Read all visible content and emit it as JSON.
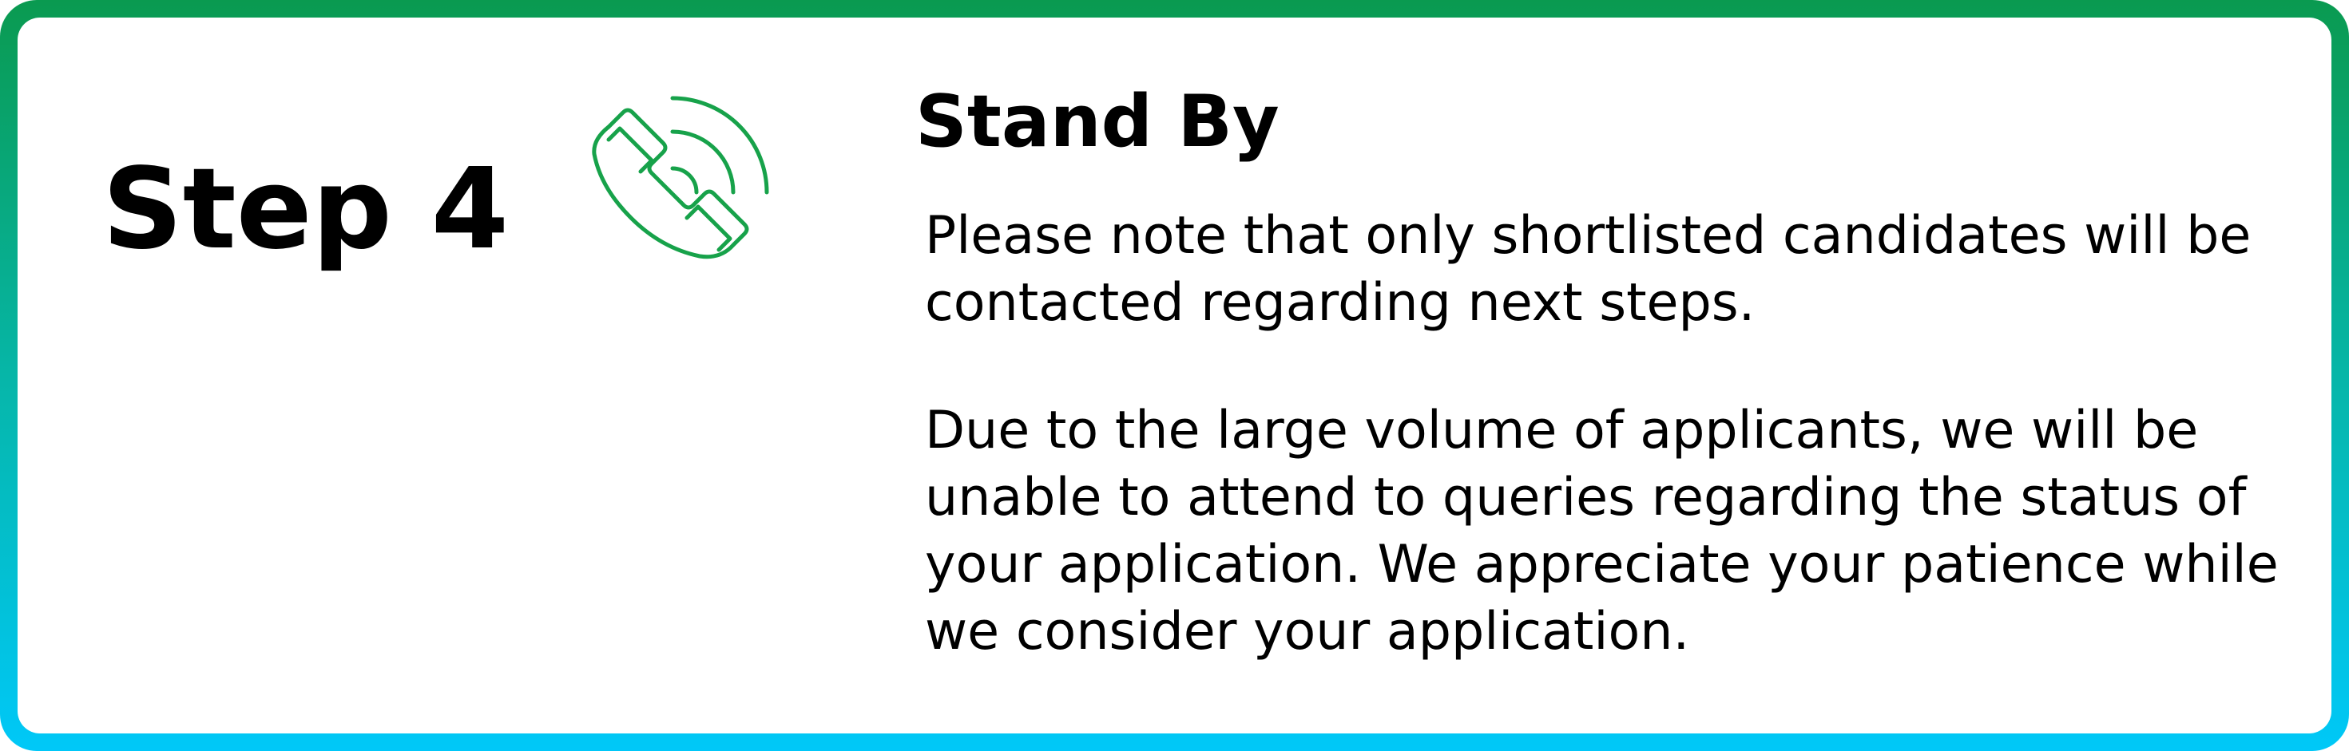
{
  "step": {
    "label": "Step 4"
  },
  "icon": {
    "name": "phone-ringing-icon",
    "color": "#17a24a"
  },
  "content": {
    "heading": "Stand By",
    "paragraph_1": [
      "Please note that only shortlisted candidates will be",
      "contacted regarding next steps."
    ],
    "paragraph_2": [
      "Due to the large volume of applicants, we will be",
      "unable to attend to queries regarding the status of",
      "your application. We appreciate your patience while",
      "we consider your application."
    ]
  },
  "colors": {
    "border_top": "#0a9a50",
    "border_bottom": "#00c8f8",
    "text": "#000000",
    "background": "#ffffff"
  }
}
